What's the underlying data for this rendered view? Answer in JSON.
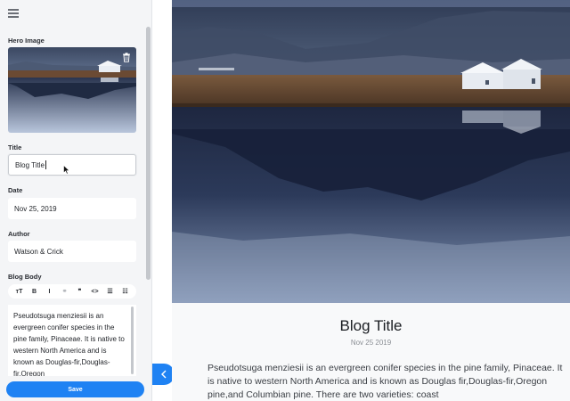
{
  "sidebar": {
    "hero_label": "Hero Image",
    "title_label": "Title",
    "title_value": "Blog Title",
    "date_label": "Date",
    "date_value": "Nov 25, 2019",
    "author_label": "Author",
    "author_value": "Watson & Crick",
    "body_label": "Blog Body",
    "toolbar": [
      {
        "name": "font-size-icon",
        "glyph": "тT"
      },
      {
        "name": "bold-icon",
        "glyph": "B"
      },
      {
        "name": "italic-icon",
        "glyph": "I"
      },
      {
        "name": "link-icon",
        "glyph": "⚭"
      },
      {
        "name": "quote-icon",
        "glyph": "❞"
      },
      {
        "name": "code-icon",
        "glyph": "<>"
      },
      {
        "name": "bulleted-list-icon",
        "glyph": "☰"
      },
      {
        "name": "numbered-list-icon",
        "glyph": "☷"
      }
    ],
    "body_value": "Pseudotsuga menziesii is an evergreen conifer species in the pine family, Pinaceae. It is native to western North America and is known as Douglas-fir,Douglas-fir,Oregon",
    "save_label": "Save"
  },
  "preview": {
    "title": "Blog Title",
    "date": "Nov 25 2019",
    "body": "Pseudotsuga menziesii is an evergreen conifer species in the pine family, Pinaceae. It is native to western North America and is known as Douglas fir,Douglas-fir,Oregon pine,and Columbian pine. There are two varieties: coast"
  },
  "colors": {
    "accent": "#1f82f3",
    "sidebar_bg": "#f4f5f7"
  }
}
